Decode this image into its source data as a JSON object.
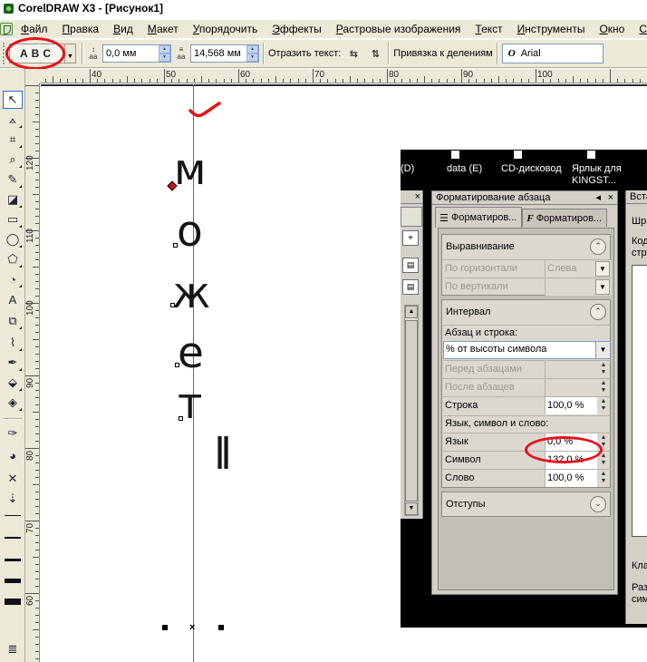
{
  "window": {
    "title": "CorelDRAW X3 - [Рисунок1]"
  },
  "menu": [
    {
      "label": "Файл",
      "ul": "Ф"
    },
    {
      "label": "Правка",
      "ul": "П"
    },
    {
      "label": "Вид",
      "ul": "В"
    },
    {
      "label": "Макет",
      "ul": "М"
    },
    {
      "label": "Упорядочить",
      "ul": "У"
    },
    {
      "label": "Эффекты",
      "ul": "Э"
    },
    {
      "label": "Растровые изображения",
      "ul": "Р"
    },
    {
      "label": "Текст",
      "ul": "Т"
    },
    {
      "label": "Инструменты",
      "ul": "И"
    },
    {
      "label": "Окно",
      "ul": "О"
    },
    {
      "label": "Спр",
      "ul": "С"
    }
  ],
  "property_bar": {
    "text_path_preset": "ABC",
    "offset_x": "0,0 мм",
    "offset_y": "14,568 мм",
    "mirror_text_label": "Отразить текст:",
    "snap_label": "Привязка к делениям",
    "font_icon": "O",
    "font_name": "Arial"
  },
  "ruler": {
    "h_labels": [
      "40",
      "50",
      "60",
      "70",
      "80",
      "90",
      "100"
    ],
    "v_labels": [
      "120",
      "110",
      "100",
      "90",
      "80",
      "70",
      "60"
    ]
  },
  "canvas": {
    "vertical_text": [
      "м",
      "о",
      "ж",
      "е",
      "т",
      "ll"
    ]
  },
  "desktop": {
    "items": [
      "(D)",
      "data (E)",
      "CD-дисковод",
      "Ярлык для KINGST..."
    ]
  },
  "left_panel": {
    "title": ""
  },
  "panel": {
    "title": "Форматирование абзаца",
    "tabs": [
      "Форматиров...",
      "Форматиров..."
    ],
    "sections": {
      "alignment": {
        "title": "Выравнивание",
        "rows": [
          {
            "label": "По горизонтали",
            "value": "Слева"
          },
          {
            "label": "По вертикали",
            "value": ""
          }
        ]
      },
      "spacing": {
        "title": "Интервал",
        "para_line_label": "Абзац и строка:",
        "mode": "% от высоты символа",
        "rows": [
          {
            "label": "Перед абзацами",
            "value": ""
          },
          {
            "label": "После абзацев",
            "value": ""
          },
          {
            "label": "Строка",
            "value": "100,0 %"
          }
        ],
        "lang_label": "Язык, символ и слово:",
        "rows2": [
          {
            "label": "Язык",
            "value": "0,0 %"
          },
          {
            "label": "Символ",
            "value": "132,0 %"
          },
          {
            "label": "Слово",
            "value": "100,0 %"
          }
        ]
      },
      "indents": {
        "title": "Отступы"
      }
    }
  },
  "right_panel": {
    "title": "Вста",
    "lines": [
      "Шр",
      "Код",
      "стр",
      "Кла",
      "Раз",
      "сим"
    ]
  },
  "annotation_color": "#e8101a"
}
